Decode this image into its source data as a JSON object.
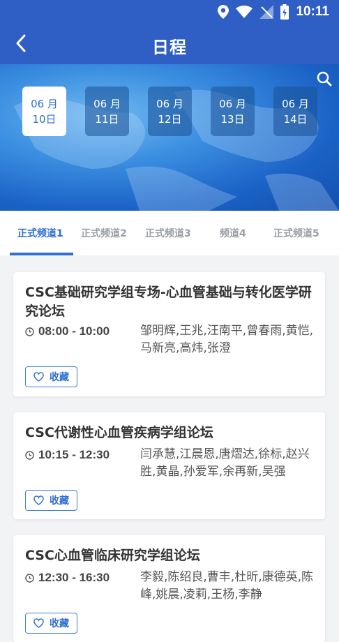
{
  "status": {
    "time": "10:11"
  },
  "header": {
    "title": "日程"
  },
  "dates": [
    {
      "month": "06 月",
      "day": "10日",
      "active": true
    },
    {
      "month": "06 月",
      "day": "11日",
      "active": false
    },
    {
      "month": "06 月",
      "day": "12日",
      "active": false
    },
    {
      "month": "06 月",
      "day": "13日",
      "active": false
    },
    {
      "month": "06 月",
      "day": "14日",
      "active": false
    }
  ],
  "tabs": [
    "正式频道1",
    "正式频道2",
    "正式频道3",
    "频道4",
    "正式频道5"
  ],
  "sessions": [
    {
      "title": "CSC基础研究学组专场-心血管基础与转化医学研究论坛",
      "time": "08:00 - 10:00",
      "speakers": "邹明辉,王兆,汪南平,曾春雨,黄恺,马新亮,高炜,张澄",
      "fav_label": "收藏"
    },
    {
      "title": "CSC代谢性心血管疾病学组论坛",
      "time": "10:15 - 12:30",
      "speakers": "闫承慧,江晨恩,唐熠达,徐标,赵兴胜,黄晶,孙爱军,余再新,吴强",
      "fav_label": "收藏"
    },
    {
      "title": "CSC心血管临床研究学组论坛",
      "time": "12:30 - 16:30",
      "speakers": "李毅,陈绍良,曹丰,杜昕,康德英,陈峰,姚晨,凌莉,王杨,李静",
      "fav_label": "收藏"
    }
  ]
}
